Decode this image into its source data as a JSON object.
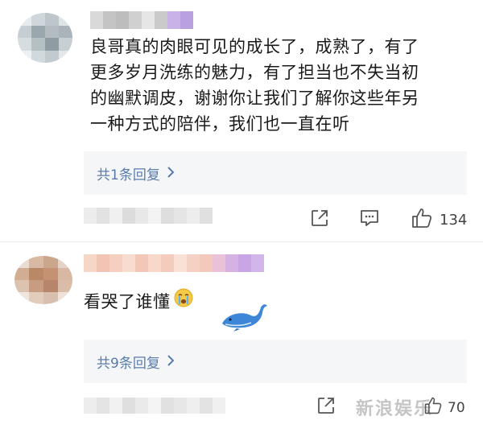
{
  "comments": [
    {
      "text_lines": [
        "良哥真的肉眼可见的成长了，成熟了，有了",
        "更多岁月洗练的魅力，有了担当也不失当初",
        "的幽默调皮，谢谢你让我们了解你这些年另",
        "一种方式的陪伴，我们也一直在听"
      ],
      "reply_label": "共1条回复",
      "like_count": "134"
    },
    {
      "text": "看哭了谁懂",
      "reply_label": "共9条回复",
      "like_count": "70"
    }
  ],
  "watermark": "新浪娱乐",
  "icons": {
    "share": "share-icon",
    "comment": "comment-icon",
    "like": "thumbs-up-icon",
    "chevron": "chevron-right-icon",
    "emoji": "crying-emoji-icon",
    "whale": "whale-sticker"
  },
  "colors": {
    "link": "#5a7cac",
    "reply_bg": "#f5f6f8",
    "accent_pink": "#f1a9bc",
    "accent_purple": "#c8a6e6"
  }
}
